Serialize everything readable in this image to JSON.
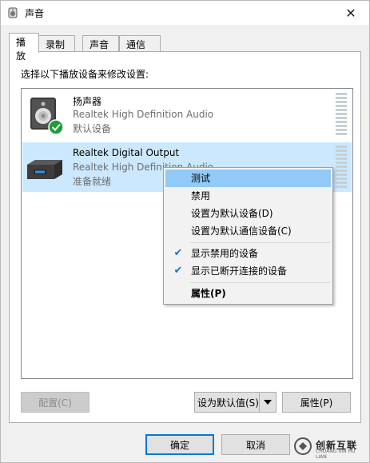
{
  "window": {
    "title": "声音",
    "close_glyph": "✕"
  },
  "tabs": [
    {
      "label": "播放",
      "active": true
    },
    {
      "label": "录制"
    },
    {
      "label": "声音"
    },
    {
      "label": "通信"
    }
  ],
  "instruction": "选择以下播放设备来修改设置:",
  "devices": [
    {
      "name": "扬声器",
      "description": "Realtek High Definition Audio",
      "status": "默认设备",
      "icon": "speaker-icon",
      "badge": "default-check-icon"
    },
    {
      "name": "Realtek Digital Output",
      "description": "Realtek High Definition Audio",
      "status": "准备就绪",
      "icon": "digital-output-icon",
      "selected": true
    }
  ],
  "context_menu": {
    "items": [
      {
        "label": "测试",
        "highlighted": true
      },
      {
        "label": "禁用"
      },
      {
        "label": "设置为默认设备(D)"
      },
      {
        "label": "设置为默认通信设备(C)"
      },
      {
        "label": "显示禁用的设备",
        "checked": true
      },
      {
        "label": "显示已断开连接的设备",
        "checked": true
      },
      {
        "label": "属性(P)",
        "bold": true
      }
    ]
  },
  "buttons": {
    "configure": "配置(C)",
    "set_default": "设为默认值(S)",
    "properties": "属性(P)",
    "ok": "确定",
    "cancel": "取消"
  },
  "watermark": {
    "text": "创新互联",
    "sub": "CHUANG XIN HU LIAN"
  },
  "colors": {
    "accent": "#0078d7",
    "selection": "#cce8ff",
    "menu_highlight": "#91c9f7",
    "check_green": "#1e9e3a"
  }
}
